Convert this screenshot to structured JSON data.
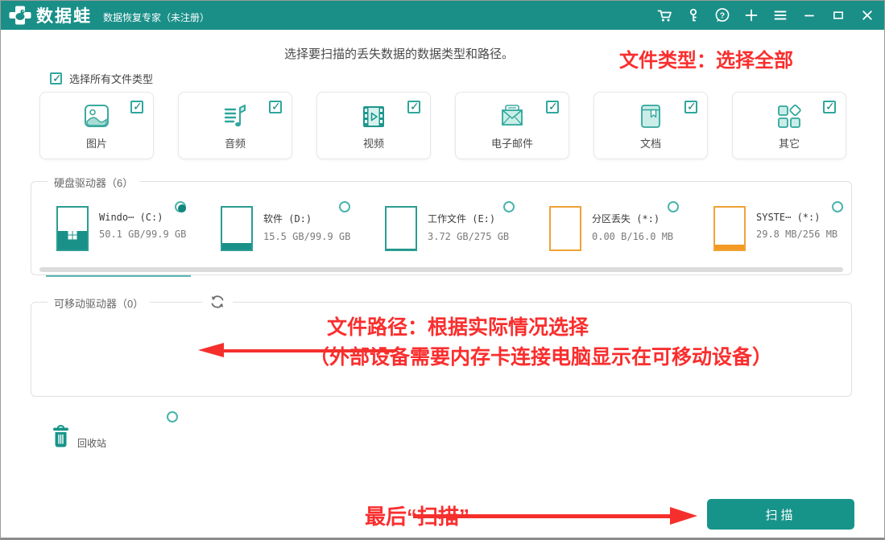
{
  "titlebar": {
    "product": "数据蛙",
    "tagline": "数据恢复专家（未注册）",
    "icons": [
      "cart-icon",
      "key-icon",
      "help-icon",
      "add-icon",
      "menu-icon",
      "minimize-icon",
      "maximize-icon",
      "close-icon"
    ]
  },
  "instruction": "选择要扫描的丢失数据的数据类型和路径。",
  "annotations": {
    "file_type": "文件类型：选择全部",
    "file_path_line1": "文件路径：根据实际情况选择",
    "file_path_line2": "（外部设备需要内存卡连接电脑显示在可移动设备）",
    "final_scan": "最后“扫描”"
  },
  "select_all_label": "选择所有文件类型",
  "file_types": [
    {
      "label": "图片",
      "icon": "image-icon",
      "checked": true
    },
    {
      "label": "音频",
      "icon": "audio-icon",
      "checked": true
    },
    {
      "label": "视频",
      "icon": "video-icon",
      "checked": true
    },
    {
      "label": "电子邮件",
      "icon": "email-icon",
      "checked": true
    },
    {
      "label": "文档",
      "icon": "document-icon",
      "checked": true
    },
    {
      "label": "其它",
      "icon": "other-icon",
      "checked": true
    }
  ],
  "drive_section": {
    "title": "硬盘驱动器（6）",
    "drives": [
      {
        "name": "Windo⋯ (C:)",
        "size": "50.1 GB/99.9 GB",
        "fill": "45%",
        "color": "teal",
        "selected": true
      },
      {
        "name": "软件 (D:)",
        "size": "15.5 GB/99.9 GB",
        "fill": "16%",
        "color": "teal",
        "selected": false
      },
      {
        "name": "工作文件 (E:)",
        "size": "3.72 GB/275 GB",
        "fill": "2%",
        "color": "teal",
        "selected": false
      },
      {
        "name": "分区丢失 (*:)",
        "size": "0.00  B/16.0 MB",
        "fill": "0%",
        "color": "orange",
        "selected": false
      },
      {
        "name": "SYSTE⋯ (*:)",
        "size": "29.8 MB/256 MB",
        "fill": "12%",
        "color": "orange",
        "selected": false
      }
    ]
  },
  "removable_section": {
    "title": "可移动驱动器（0）",
    "refresh_icon": "refresh-icon"
  },
  "recycle_bin": {
    "label": "回收站",
    "icon": "trash-icon",
    "selected": false
  },
  "scan_button_label": "扫描",
  "colors": {
    "titlebar_teal": "#1A8F88",
    "accent_teal": "#17948A",
    "orange": "#F0A236",
    "annotation_red": "#FA2E2E"
  }
}
